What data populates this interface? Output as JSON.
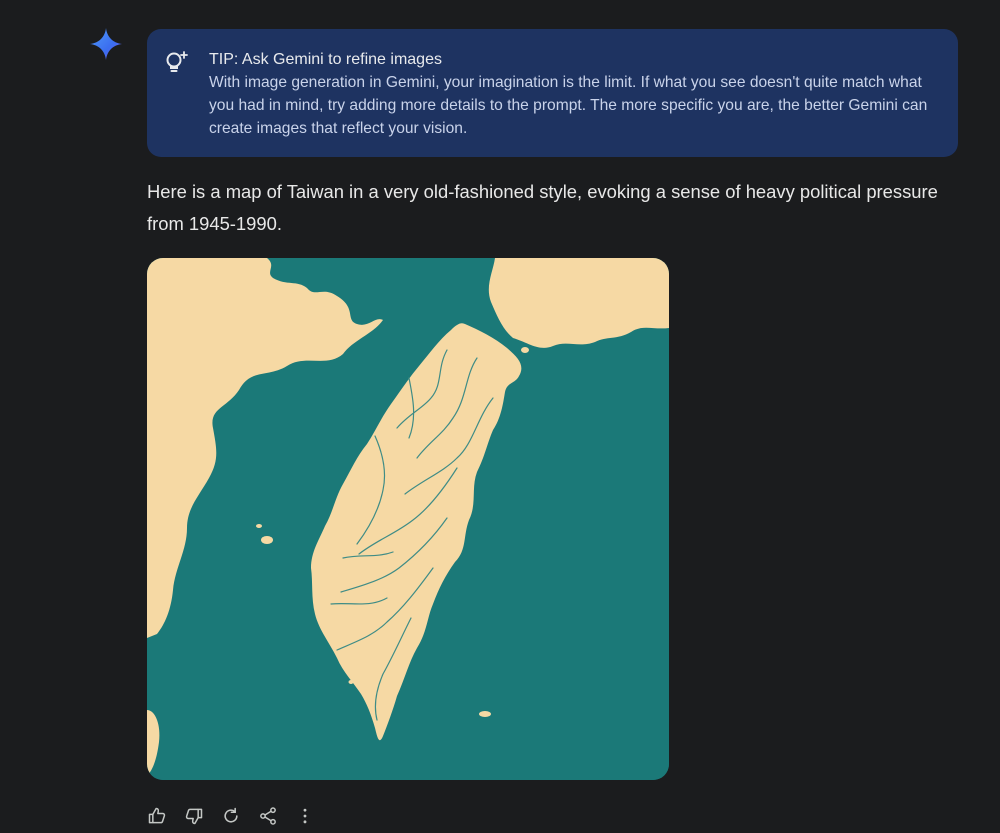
{
  "tip": {
    "title": "TIP: Ask Gemini to refine images",
    "body": "With image generation in Gemini, your imagination is the limit. If what you see doesn't quite match what you had in mind, try adding more details to the prompt. The more specific you are, the better Gemini can create images that reflect your vision."
  },
  "response": {
    "text": "Here is a map of Taiwan in a very old-fashioned style, evoking a sense of heavy political pressure from 1945-1990."
  },
  "image": {
    "alt": "Stylized old-fashioned map of Taiwan with teal sea and cream land",
    "colors": {
      "sea": "#1b7978",
      "land": "#f6d9a4",
      "river": "#3f8c86"
    }
  },
  "actions": [
    {
      "name": "thumb-up-icon",
      "label": "Good response"
    },
    {
      "name": "thumb-down-icon",
      "label": "Bad response"
    },
    {
      "name": "redo-icon",
      "label": "Redo"
    },
    {
      "name": "share-icon",
      "label": "Share"
    },
    {
      "name": "more-vert-icon",
      "label": "More"
    }
  ],
  "colors": {
    "background": "#1b1c1e",
    "tip_card": "#1e3361",
    "accent": "#4a8cf7"
  }
}
